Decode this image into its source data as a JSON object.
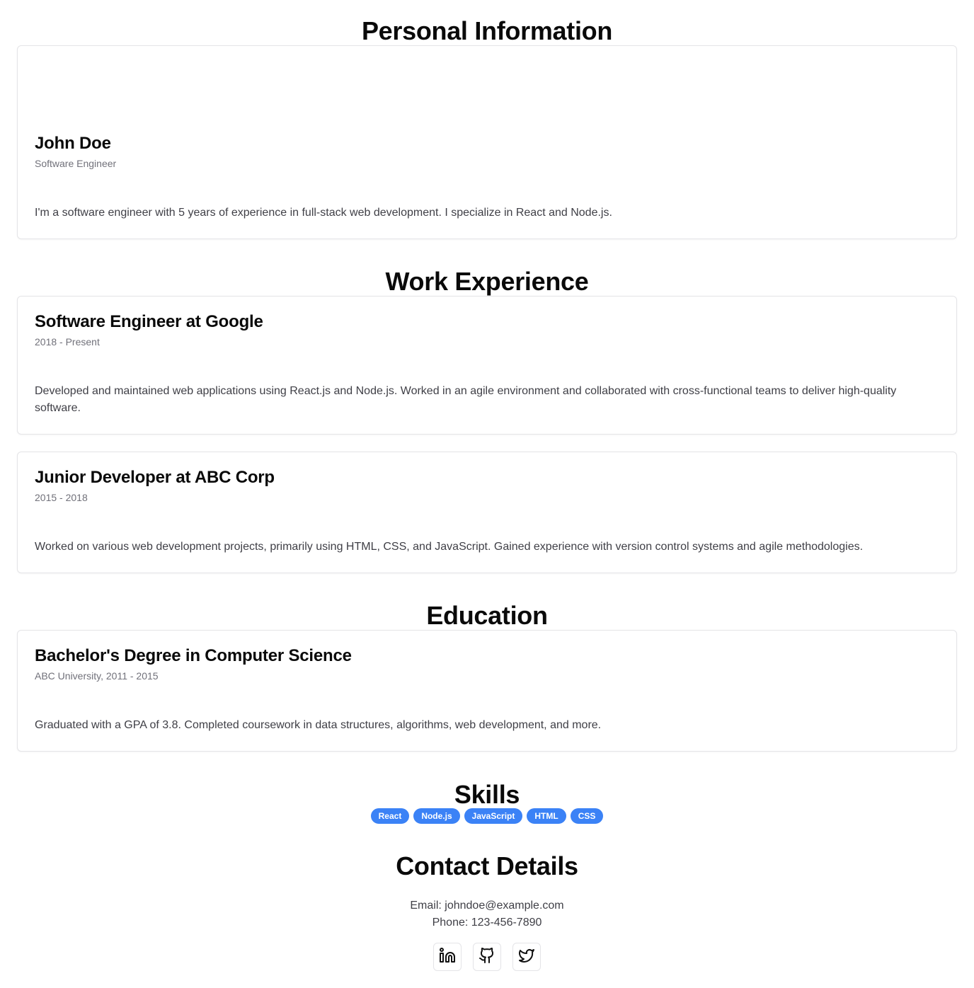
{
  "personal": {
    "section_title": "Personal Information",
    "name": "John Doe",
    "role": "Software Engineer",
    "bio": "I'm a software engineer with 5 years of experience in full-stack web development. I specialize in React and Node.js."
  },
  "work": {
    "section_title": "Work Experience",
    "jobs": [
      {
        "title": "Software Engineer at Google",
        "period": "2018 - Present",
        "description": "Developed and maintained web applications using React.js and Node.js. Worked in an agile environment and collaborated with cross-functional teams to deliver high-quality software."
      },
      {
        "title": "Junior Developer at ABC Corp",
        "period": "2015 - 2018",
        "description": "Worked on various web development projects, primarily using HTML, CSS, and JavaScript. Gained experience with version control systems and agile methodologies."
      }
    ]
  },
  "education": {
    "section_title": "Education",
    "items": [
      {
        "degree": "Bachelor's Degree in Computer Science",
        "school": "ABC University, 2011 - 2015",
        "description": "Graduated with a GPA of 3.8. Completed coursework in data structures, algorithms, web development, and more."
      }
    ]
  },
  "skills": {
    "section_title": "Skills",
    "items": [
      "React",
      "Node.js",
      "JavaScript",
      "HTML",
      "CSS"
    ],
    "badge_color": "#3b82f6"
  },
  "contact": {
    "section_title": "Contact Details",
    "email_line": "Email: johndoe@example.com",
    "phone_line": "Phone: 123-456-7890",
    "socials": [
      {
        "icon": "linkedin-icon"
      },
      {
        "icon": "github-icon"
      },
      {
        "icon": "twitter-icon"
      }
    ]
  }
}
